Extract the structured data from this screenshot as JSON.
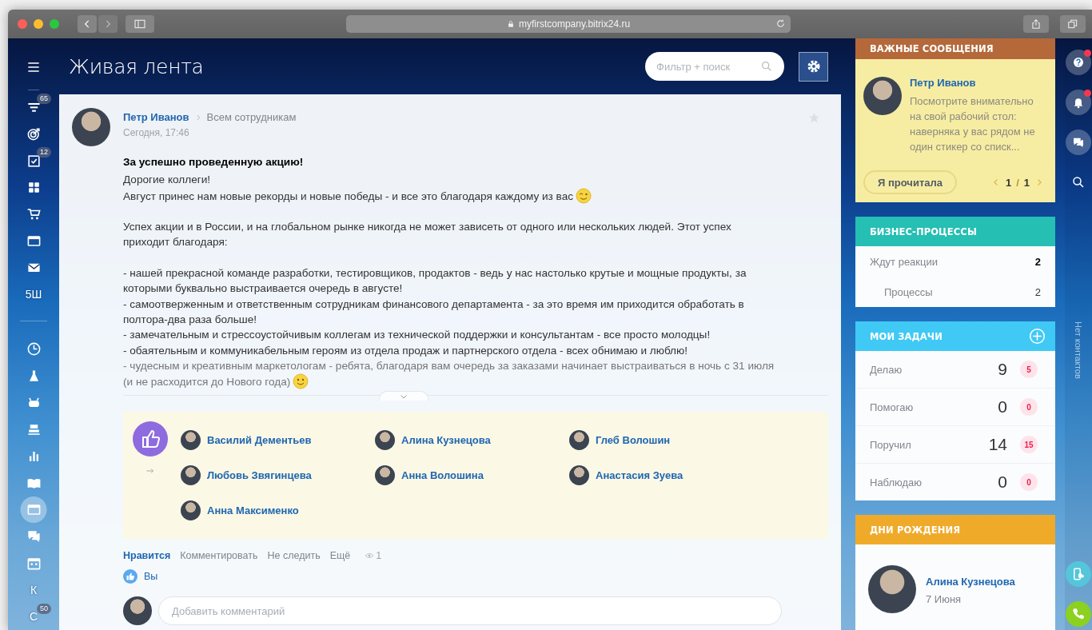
{
  "browser": {
    "url": "myfirstcompany.bitrix24.ru"
  },
  "header": {
    "title": "Живая лента",
    "search": {
      "placeholder": "Фильтр + поиск"
    }
  },
  "sidebar": {
    "groups": [
      [
        {
          "kind": "icon",
          "badge": "65",
          "selected": false
        },
        {
          "kind": "icon",
          "selected": false
        },
        {
          "kind": "icon",
          "badge": "12",
          "selected": false
        },
        {
          "kind": "icon",
          "selected": false
        },
        {
          "kind": "icon",
          "selected": false
        },
        {
          "kind": "icon",
          "selected": false
        },
        {
          "kind": "icon",
          "selected": false
        },
        {
          "kind": "text",
          "text": "5Ш",
          "selected": false
        }
      ],
      [
        {
          "kind": "icon",
          "selected": false
        },
        {
          "kind": "icon",
          "selected": false
        },
        {
          "kind": "icon",
          "selected": false
        },
        {
          "kind": "icon",
          "selected": false
        },
        {
          "kind": "icon",
          "selected": false
        },
        {
          "kind": "icon",
          "selected": false
        },
        {
          "kind": "icon",
          "selected": true
        },
        {
          "kind": "icon",
          "selected": false
        },
        {
          "kind": "icon",
          "selected": false
        },
        {
          "kind": "text",
          "text": "К",
          "selected": false
        },
        {
          "kind": "text",
          "text": "С",
          "badge": "50",
          "selected": false
        }
      ]
    ]
  },
  "post": {
    "author": "Петр Иванов",
    "audience": "Всем сотрудникам",
    "date": "Сегодня, 17:46",
    "favorite": false,
    "title": "За успешно проведенную акцию!",
    "paragraphs": [
      [
        {
          "kind": "plain",
          "text": "Дорогие коллеги!"
        },
        {
          "kind": "wink",
          "text": "Август принес нам новые рекорды и новые победы - и все это благодаря каждому из вас"
        }
      ],
      [
        {
          "kind": "plain",
          "text": "Успех акции и в России, и на глобальном рынке никогда не может зависеть от одного или нескольких людей. Этот успех приходит благодаря:"
        }
      ],
      [
        {
          "kind": "plain",
          "text": "- нашей прекрасной команде разработки, тестировщиков, продактов - ведь у нас настолько крутые и мощные продукты, за которыми буквально выстраивается очередь в августе!"
        },
        {
          "kind": "plain",
          "text": "- самоотверженным и ответственным сотрудникам финансового департамента - за это время им приходится обработать в полтора-два раза больше!"
        },
        {
          "kind": "plain",
          "text": "- замечательным и стрессоустойчивым коллегам из технической поддержки и консультантам - все просто молодцы!"
        },
        {
          "kind": "plain",
          "text": "- обаятельным и коммуникабельным героям из отдела продаж и партнерского отдела - всех обнимаю и люблю!"
        },
        {
          "kind": "smile",
          "text": "- чудесным и креативным маркетологам - ребята, благодаря вам очередь за заказами начинает выстраиваться в ночь с 31 июля (и не расходится до Нового года)"
        }
      ]
    ],
    "likers": [
      "Василий Дементьев",
      "Алина Кузнецова",
      "Глеб Волошин",
      "Любовь Звягинцева",
      "Анна Волошина",
      "Анастасия Зуева",
      "Анна Максименко"
    ],
    "actions": [
      {
        "label": "Нравится",
        "selected": true
      },
      {
        "label": "Комментировать",
        "selected": false
      },
      {
        "label": "Не следить",
        "selected": false
      },
      {
        "label": "Ещё",
        "selected": false
      }
    ],
    "views": "1",
    "liked_by": "Вы",
    "comment": {
      "placeholder": "Добавить комментарий"
    }
  },
  "important": {
    "title": "ВАЖНЫЕ СООБЩЕНИЯ",
    "author": "Петр Иванов",
    "text": "Посмотрите внимательно на свой рабочий стол: наверняка у вас рядом не один стикер со списк...",
    "button": "Я прочитала",
    "page": "1",
    "separator": "/",
    "pages": "1"
  },
  "business": {
    "title": "БИЗНЕС-ПРОЦЕССЫ",
    "rows": [
      {
        "kind": "summary",
        "label": "Ждут реакции",
        "value": "2"
      },
      {
        "kind": "sub",
        "label": "Процессы",
        "value": "2"
      }
    ]
  },
  "tasks": {
    "title": "МОИ ЗАДАЧИ",
    "rows": [
      {
        "label": "Делаю",
        "count": "9",
        "badge": "5"
      },
      {
        "label": "Помогаю",
        "count": "0",
        "badge": "0"
      },
      {
        "label": "Поручил",
        "count": "14",
        "badge": "15"
      },
      {
        "label": "Наблюдаю",
        "count": "0",
        "badge": "0"
      }
    ]
  },
  "birthdays": {
    "title": "ДНИ РОЖДЕНИЯ",
    "people": [
      {
        "name": "Алина Кузнецова",
        "date": "7 Июня"
      }
    ]
  },
  "right_strip": {
    "buttons": [
      {
        "notify": true
      },
      {
        "notify": true
      },
      {
        "notify": false
      },
      {
        "notify": false
      }
    ],
    "contacts": "Нет контактов"
  }
}
